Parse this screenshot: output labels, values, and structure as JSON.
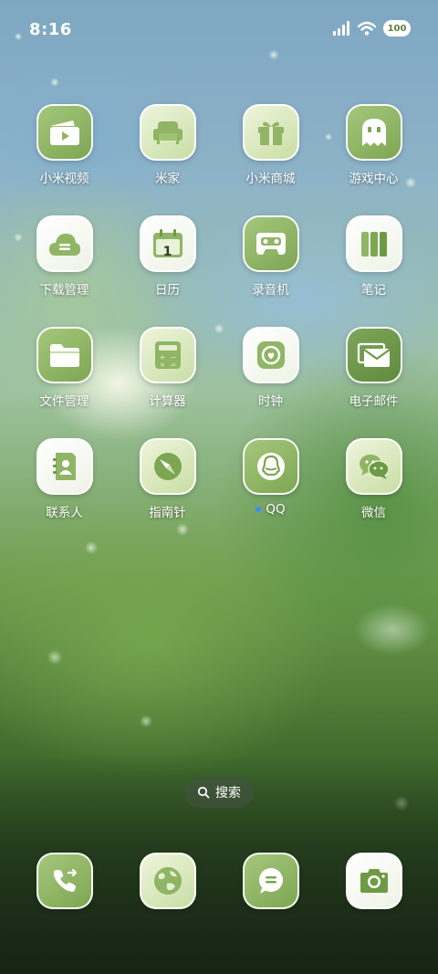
{
  "status_bar": {
    "time": "8:16",
    "battery_level": "100",
    "icons": [
      "signal-icon",
      "wifi-icon",
      "battery-icon"
    ]
  },
  "apps": [
    {
      "label": "小米视频",
      "icon": "video-icon",
      "style": "green"
    },
    {
      "label": "米家",
      "icon": "sofa-icon",
      "style": "light"
    },
    {
      "label": "小米商城",
      "icon": "gift-icon",
      "style": "light"
    },
    {
      "label": "游戏中心",
      "icon": "ghost-icon",
      "style": "green"
    },
    {
      "label": "下载管理",
      "icon": "download-cloud-icon",
      "style": "white"
    },
    {
      "label": "日历",
      "icon": "calendar-icon",
      "style": "white",
      "badge_text": "1"
    },
    {
      "label": "录音机",
      "icon": "cassette-icon",
      "style": "green"
    },
    {
      "label": "笔记",
      "icon": "notes-icon",
      "style": "white"
    },
    {
      "label": "文件管理",
      "icon": "folder-icon",
      "style": "green"
    },
    {
      "label": "计算器",
      "icon": "calculator-icon",
      "style": "light"
    },
    {
      "label": "时钟",
      "icon": "clock-icon",
      "style": "white"
    },
    {
      "label": "电子邮件",
      "icon": "mail-icon",
      "style": "green"
    },
    {
      "label": "联系人",
      "icon": "contacts-icon",
      "style": "white"
    },
    {
      "label": "指南针",
      "icon": "compass-icon",
      "style": "light"
    },
    {
      "label": "QQ",
      "icon": "qq-penguin-icon",
      "style": "green",
      "new_indicator": true
    },
    {
      "label": "微信",
      "icon": "wechat-icon",
      "style": "light"
    }
  ],
  "search": {
    "label": "搜索"
  },
  "dock": [
    {
      "icon": "phone-icon",
      "style": "green"
    },
    {
      "icon": "browser-globe-icon",
      "style": "light"
    },
    {
      "icon": "messages-icon",
      "style": "green"
    },
    {
      "icon": "camera-icon",
      "style": "white"
    }
  ],
  "colors": {
    "icon_green": "#8fb565",
    "icon_dark_green": "#6f9a45",
    "icon_light": "#e5efcf",
    "label_text": "#ffffff",
    "notification_dot": "#3f8cff"
  }
}
